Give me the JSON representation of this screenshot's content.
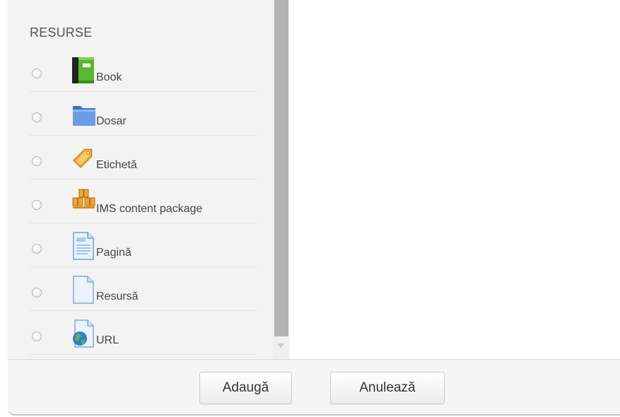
{
  "section": {
    "title": "RESURSE"
  },
  "items": [
    {
      "label": "Book",
      "icon": "book-icon"
    },
    {
      "label": "Dosar",
      "icon": "folder-icon"
    },
    {
      "label": "Etichetă",
      "icon": "label-tag-icon"
    },
    {
      "label": "IMS content package",
      "icon": "ims-package-icon"
    },
    {
      "label": "Pagină",
      "icon": "page-icon"
    },
    {
      "label": "Resursă",
      "icon": "file-icon"
    },
    {
      "label": "URL",
      "icon": "url-globe-icon"
    }
  ],
  "footer": {
    "add_label": "Adaugă",
    "cancel_label": "Anulează"
  },
  "colors": {
    "panel_background": "#f3f3f3",
    "scrollbar_thumb": "#b3b3b3",
    "book_green": "#5cb82e",
    "folder_blue": "#5b8ed6",
    "tag_orange": "#f0a630"
  }
}
